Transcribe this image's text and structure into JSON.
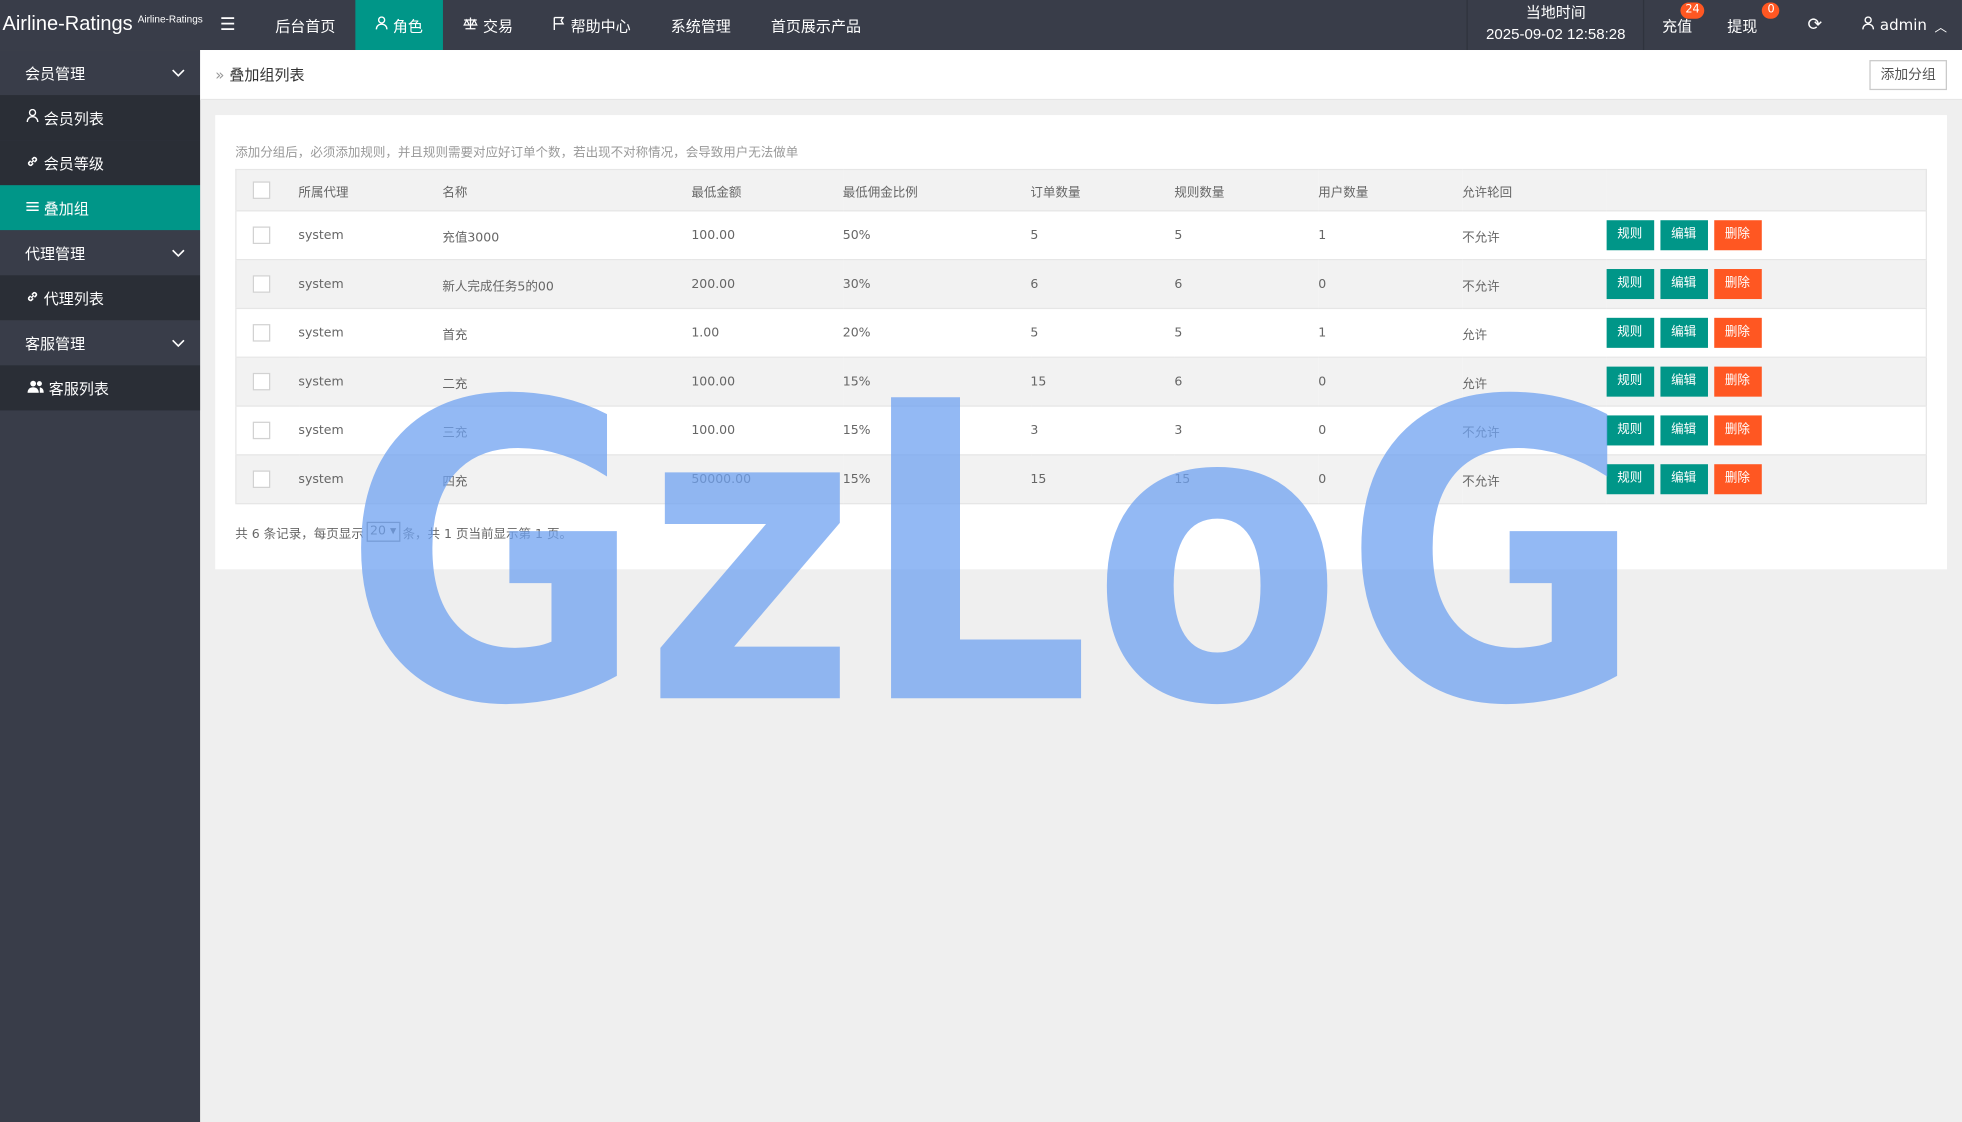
{
  "header": {
    "logo_main": "Airline-Ratings",
    "logo_sub": "Airline-Ratings",
    "nav": [
      {
        "label": "后台首页",
        "icon": ""
      },
      {
        "label": "角色",
        "icon": "user-icon",
        "active": true
      },
      {
        "label": "交易",
        "icon": "scale-icon"
      },
      {
        "label": "帮助中心",
        "icon": "flag-icon"
      },
      {
        "label": "系统管理",
        "icon": ""
      },
      {
        "label": "首页展示产品",
        "icon": ""
      }
    ],
    "time_label": "当地时间",
    "time_value": "2025-09-02 12:58:28",
    "recharge_label": "充值",
    "recharge_badge": "24",
    "withdraw_label": "提现",
    "withdraw_badge": "0",
    "user": "admin"
  },
  "sidebar": {
    "groups": [
      {
        "label": "会员管理",
        "items": [
          {
            "label": "会员列表",
            "icon": "user-icon"
          },
          {
            "label": "会员等级",
            "icon": "link-icon"
          },
          {
            "label": "叠加组",
            "icon": "list-icon",
            "active": true
          }
        ]
      },
      {
        "label": "代理管理",
        "items": [
          {
            "label": "代理列表",
            "icon": "link-icon"
          }
        ]
      },
      {
        "label": "客服管理",
        "items": [
          {
            "label": "客服列表",
            "icon": "users-icon"
          }
        ]
      }
    ]
  },
  "page": {
    "breadcrumb": "叠加组列表",
    "add_button": "添加分组",
    "notice": "添加分组后，必须添加规则，并且规则需要对应好订单个数，若出现不对称情况，会导致用户无法做单"
  },
  "table": {
    "columns": [
      "所属代理",
      "名称",
      "最低金额",
      "最低佣金比例",
      "订单数量",
      "规则数量",
      "用户数量",
      "允许轮回"
    ],
    "rows": [
      [
        "system",
        "充值3000",
        "100.00",
        "50%",
        "5",
        "5",
        "1",
        "不允许"
      ],
      [
        "system",
        "新人完成任务5的00",
        "200.00",
        "30%",
        "6",
        "6",
        "0",
        "不允许"
      ],
      [
        "system",
        "首充",
        "1.00",
        "20%",
        "5",
        "5",
        "1",
        "允许"
      ],
      [
        "system",
        "二充",
        "100.00",
        "15%",
        "15",
        "6",
        "0",
        "允许"
      ],
      [
        "system",
        "三充",
        "100.00",
        "15%",
        "3",
        "3",
        "0",
        "不允许"
      ],
      [
        "system",
        "四充",
        "50000.00",
        "15%",
        "15",
        "15",
        "0",
        "不允许"
      ]
    ],
    "actions": {
      "rule": "规则",
      "edit": "编辑",
      "delete": "删除"
    }
  },
  "pager": {
    "prefix": "共 6 条记录，每页显示",
    "page_size": "20",
    "suffix": "条，共 1 页当前显示第 1 页。"
  },
  "watermark": "GzLoG",
  "colors": {
    "accent": "#009688",
    "danger": "#ff5722",
    "topbar": "#393d49",
    "watermark": "#6fa2f0"
  }
}
